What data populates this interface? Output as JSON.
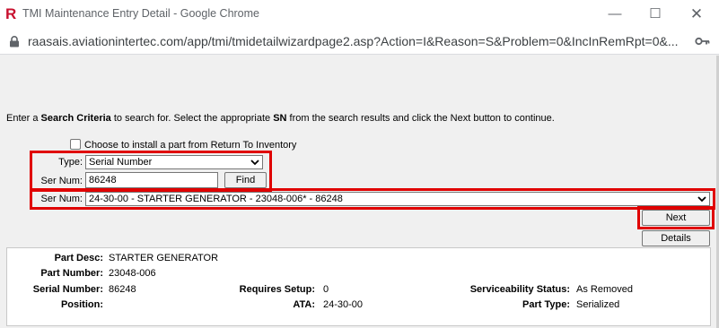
{
  "window": {
    "title": "TMI Maintenance Entry Detail - Google Chrome",
    "url": "raasais.aviationintertec.com/app/tmi/tmidetailwizardpage2.asp?Action=I&Reason=S&Problem=0&IncInRemRpt=0&..."
  },
  "instructions": {
    "part1": "Enter a ",
    "bold1": "Search Criteria",
    "part2": " to search for. Select the appropriate ",
    "bold2": "SN",
    "part3": " from the search results and click the Next button to continue."
  },
  "form": {
    "return_inventory_label": "Choose to install a part from Return To Inventory",
    "type_label": "Type:",
    "type_value": "Serial Number",
    "sernum_label": "Ser Num:",
    "sernum_value": "86248",
    "find_label": "Find",
    "result_label": "Ser Num:",
    "result_value": "24-30-00 - STARTER GENERATOR - 23048-006* - 86248",
    "next_label": "Next",
    "details_label": "Details"
  },
  "details": {
    "part_desc_label": "Part Desc:",
    "part_desc": "STARTER GENERATOR",
    "part_number_label": "Part Number:",
    "part_number": "23048-006",
    "serial_number_label": "Serial Number:",
    "serial_number": "86248",
    "position_label": "Position:",
    "position": "",
    "requires_setup_label": "Requires Setup:",
    "requires_setup": "0",
    "ata_label": "ATA:",
    "ata": "24-30-00",
    "serviceability_label": "Serviceability Status:",
    "serviceability": "As Removed",
    "part_type_label": "Part Type:",
    "part_type": "Serialized"
  },
  "colors": {
    "highlight": "#e00000",
    "logo": "#c8102e"
  },
  "icons": [
    "app-logo",
    "minimize-icon",
    "maximize-icon",
    "close-icon",
    "lock-icon",
    "key-icon",
    "dropdown-arrow-icon"
  ]
}
